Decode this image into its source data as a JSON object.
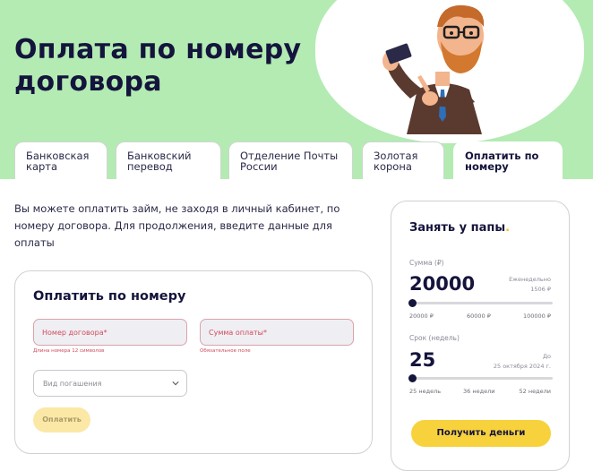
{
  "hero": {
    "title": "Оплата по номеру договора"
  },
  "tabs": [
    {
      "label": "Банковская карта"
    },
    {
      "label": "Банковский перевод"
    },
    {
      "label": "Отделение Почты России"
    },
    {
      "label": "Золотая корона"
    },
    {
      "label": "Оплатить по номеру",
      "active": true
    }
  ],
  "intro": "Вы можете оплатить займ, не заходя в личный кабинет, по номеру договора. Для продолжения, введите данные для оплаты",
  "pay_form": {
    "title": "Оплатить по номеру",
    "contract_placeholder": "Номер договора*",
    "contract_hint": "Длина номера 12 символов",
    "amount_placeholder": "Сумма оплаты*",
    "amount_hint": "Обязательное поле",
    "repay_type_placeholder": "Вид погашения",
    "submit_label": "Оплатить"
  },
  "loan_widget": {
    "title": "Занять у папы",
    "title_dot": ".",
    "sum_label": "Сумма (₽)",
    "sum_value": "20000",
    "weekly_label": "Еженедельно",
    "weekly_value": "1506 ₽",
    "sum_slider": {
      "min_label": "20000 ₽",
      "mid_label": "60000 ₽",
      "max_label": "100000 ₽",
      "value": 20000,
      "min": 20000,
      "max": 100000
    },
    "term_label": "Срок (недель)",
    "term_value": "25",
    "until_label": "До",
    "until_value": "25 октября 2024 г.",
    "term_slider": {
      "min_label": "25 недель",
      "mid_label": "36 недели",
      "max_label": "52 недели",
      "value": 25,
      "min": 25,
      "max": 52
    },
    "cta_label": "Получить деньги"
  },
  "colors": {
    "hero_bg": "#b3ebb3",
    "accent_yellow": "#f7d23c",
    "error_red": "#d04a5c",
    "text_dark": "#14143c"
  },
  "icons": [
    "mascot-illustration",
    "chevron-down-icon"
  ]
}
